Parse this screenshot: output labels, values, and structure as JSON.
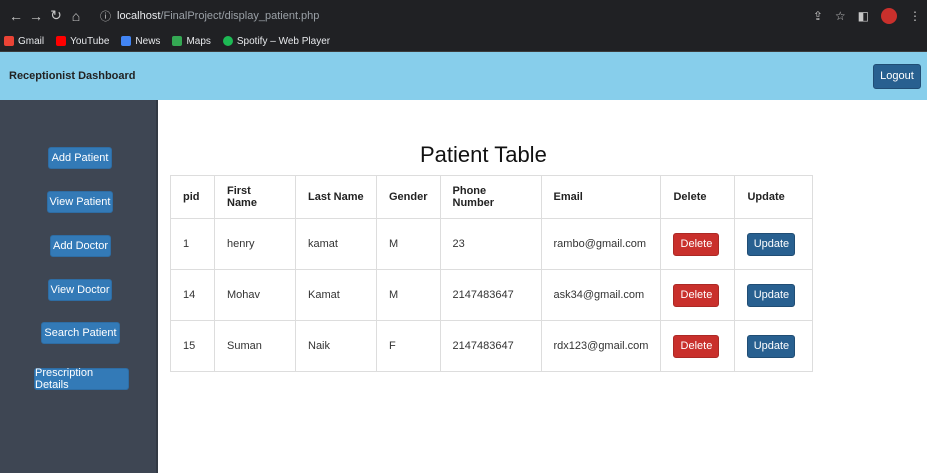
{
  "browser": {
    "url_host": "localhost",
    "url_path": "/FinalProject/display_patient.php",
    "bookmarks": [
      {
        "label": "Gmail",
        "color": "#ea4335"
      },
      {
        "label": "YouTube",
        "color": "#ff0000"
      },
      {
        "label": "News",
        "color": "#4285f4"
      },
      {
        "label": "Maps",
        "color": "#34a853"
      },
      {
        "label": "Spotify – Web Player",
        "color": "#1db954"
      }
    ]
  },
  "header": {
    "title": "Receptionist Dashboard",
    "logout_label": "Logout",
    "bg_color": "#87ceeb"
  },
  "sidebar": {
    "items": [
      {
        "label": "Add Patient"
      },
      {
        "label": "View Patient"
      },
      {
        "label": "Add Doctor"
      },
      {
        "label": "View Doctor"
      },
      {
        "label": "Search Patient"
      },
      {
        "label": "Prescription Details"
      }
    ]
  },
  "main": {
    "title": "Patient Table",
    "columns": [
      "pid",
      "First Name",
      "Last Name",
      "Gender",
      "Phone Number",
      "Email",
      "Delete",
      "Update"
    ],
    "rows": [
      {
        "pid": "1",
        "first": "henry",
        "last": "kamat",
        "gender": "M",
        "phone": "23",
        "email": "rambo@gmail.com"
      },
      {
        "pid": "14",
        "first": "Mohav",
        "last": "Kamat",
        "gender": "M",
        "phone": "2147483647",
        "email": "ask34@gmail.com"
      },
      {
        "pid": "15",
        "first": "Suman",
        "last": "Naik",
        "gender": "F",
        "phone": "2147483647",
        "email": "rdx123@gmail.com"
      }
    ],
    "delete_label": "Delete",
    "update_label": "Update"
  }
}
